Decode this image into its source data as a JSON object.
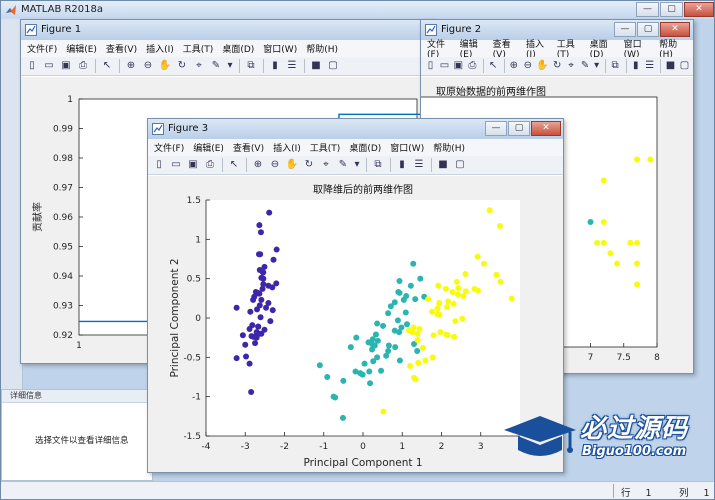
{
  "app": {
    "title": "MATLAB R2018a",
    "details_panel": {
      "header": "详细信息",
      "message": "选择文件以查看详细信息"
    },
    "status": {
      "row_label": "行",
      "row_value": "1",
      "col_label": "列",
      "col_value": "1"
    }
  },
  "window_buttons": {
    "minimize": "—",
    "restore": "▢",
    "close": "✕"
  },
  "figure_menu": [
    "文件(F)",
    "编辑(E)",
    "查看(V)",
    "插入(I)",
    "工具(T)",
    "桌面(D)",
    "窗口(W)",
    "帮助(H)"
  ],
  "toolbar_icons": [
    "new-figure-icon",
    "open-file-icon",
    "save-icon",
    "print-icon",
    "sep",
    "edit-plot-icon",
    "sep",
    "zoom-in-icon",
    "zoom-out-icon",
    "pan-icon",
    "rotate-3d-icon",
    "data-cursor-icon",
    "brush-icon",
    "brush-dropdown-icon",
    "sep",
    "link-plot-icon",
    "sep",
    "insert-colorbar-icon",
    "insert-legend-icon",
    "sep",
    "hide-plot-tools-icon",
    "show-plot-tools-icon"
  ],
  "figures": {
    "fig1": {
      "title": "Figure 1",
      "chart_data": {
        "type": "line",
        "title": "",
        "xlabel": "",
        "ylabel": "贡献率",
        "yticks": [
          "1",
          "0.99",
          "0.98",
          "0.97",
          "0.96",
          "0.95",
          "0.94",
          "0.93",
          "0.92"
        ],
        "xticks": [
          "1"
        ],
        "ylim": [
          0.92,
          1.0
        ],
        "series": [
          {
            "x": [
              1,
              2,
              3,
              4
            ],
            "y": [
              0.9246,
              0.9246,
              0.9948,
              1.0
            ]
          }
        ],
        "color": "#0072bd"
      }
    },
    "fig2": {
      "title": "Figure 2",
      "chart_data": {
        "type": "scatter",
        "title": "取原始数据的前两维作图",
        "xticks": [
          "7",
          "7.5",
          "8"
        ],
        "xlim": [
          4,
          8
        ],
        "ylim": [
          2,
          4.4
        ],
        "series": [
          {
            "color": "#3e26a8",
            "points": [
              [
                5.0,
                3.6
              ]
            ]
          },
          {
            "color": "#2ab5b0",
            "points": [
              [
                7.0,
                3.2
              ]
            ]
          },
          {
            "color": "#f9fb0e",
            "points": [
              [
                7.7,
                3.8
              ],
              [
                7.6,
                3.0
              ],
              [
                7.7,
                3.0
              ],
              [
                7.7,
                2.8
              ],
              [
                7.7,
                2.6
              ],
              [
                7.2,
                3.6
              ],
              [
                7.3,
                2.9
              ],
              [
                7.2,
                3.2
              ],
              [
                7.1,
                3.0
              ],
              [
                7.4,
                2.8
              ],
              [
                7.9,
                3.8
              ],
              [
                7.7,
                3.8
              ],
              [
                7.2,
                3.0
              ]
            ]
          }
        ]
      }
    },
    "fig3": {
      "title": "Figure 3",
      "chart_data": {
        "type": "scatter",
        "title": "取降维后的前两维作图",
        "xlabel": "Principal Component 1",
        "ylabel": "Principal Component 2",
        "xticks": [
          "-4",
          "-3",
          "-2",
          "-1",
          "0",
          "1",
          "2",
          "3"
        ],
        "yticks": [
          "1.5",
          "1",
          "0.5",
          "0",
          "-0.5",
          "-1",
          "-1.5"
        ],
        "xlim": [
          -4,
          4
        ],
        "ylim": [
          -1.5,
          1.5
        ],
        "series": [
          {
            "color": "#3e26a8",
            "points": [
              [
                -2.68,
                0.32
              ],
              [
                -2.71,
                -0.18
              ],
              [
                -2.89,
                -0.14
              ],
              [
                -2.75,
                -0.32
              ],
              [
                -2.73,
                0.33
              ],
              [
                -2.28,
                0.74
              ],
              [
                -2.82,
                -0.09
              ],
              [
                -2.63,
                0.16
              ],
              [
                -2.89,
                -0.58
              ],
              [
                -2.67,
                -0.11
              ],
              [
                -2.51,
                0.65
              ],
              [
                -2.61,
                0.01
              ],
              [
                -2.79,
                -0.24
              ],
              [
                -3.22,
                -0.51
              ],
              [
                -2.64,
                1.18
              ],
              [
                -2.39,
                1.34
              ],
              [
                -2.62,
                0.81
              ],
              [
                -2.65,
                0.31
              ],
              [
                -2.2,
                0.87
              ],
              [
                -2.59,
                0.51
              ],
              [
                -2.31,
                0.39
              ],
              [
                -2.54,
                0.43
              ],
              [
                -3.22,
                0.13
              ],
              [
                -2.3,
                0.1
              ],
              [
                -2.36,
                -0.04
              ],
              [
                -2.51,
                -0.15
              ],
              [
                -2.47,
                0.13
              ],
              [
                -2.56,
                0.37
              ],
              [
                -2.64,
                0.31
              ],
              [
                -2.63,
                -0.2
              ],
              [
                -2.59,
                -0.2
              ],
              [
                -2.41,
                0.41
              ],
              [
                -2.65,
                0.81
              ],
              [
                -2.6,
                1.09
              ],
              [
                -2.67,
                -0.11
              ],
              [
                -2.87,
                0.08
              ],
              [
                -2.63,
                0.61
              ],
              [
                -2.8,
                0.23
              ],
              [
                -2.98,
                -0.49
              ],
              [
                -2.59,
                0.23
              ],
              [
                -2.77,
                0.27
              ],
              [
                -2.85,
                -0.94
              ],
              [
                -3.0,
                -0.34
              ],
              [
                -2.41,
                0.19
              ],
              [
                -2.21,
                0.44
              ],
              [
                -2.71,
                -0.25
              ],
              [
                -2.54,
                0.5
              ],
              [
                -2.84,
                -0.23
              ],
              [
                -2.54,
                0.58
              ],
              [
                -2.7,
                0.11
              ],
              [
                -2.55,
                0.58
              ],
              [
                -3.06,
                -0.22
              ]
            ]
          },
          {
            "color": "#2ab5b0",
            "points": [
              [
                1.28,
                0.69
              ],
              [
                0.93,
                0.32
              ],
              [
                1.46,
                0.5
              ],
              [
                0.18,
                -0.83
              ],
              [
                1.09,
                0.07
              ],
              [
                0.64,
                -0.42
              ],
              [
                1.1,
                0.28
              ],
              [
                -0.75,
                -1.0
              ],
              [
                1.04,
                0.23
              ],
              [
                -0.01,
                -0.72
              ],
              [
                -0.51,
                -1.27
              ],
              [
                0.51,
                -0.1
              ],
              [
                0.26,
                -0.55
              ],
              [
                0.98,
                -0.12
              ],
              [
                -0.17,
                -0.25
              ],
              [
                0.93,
                0.47
              ],
              [
                0.66,
                -0.35
              ],
              [
                0.23,
                -0.33
              ],
              [
                0.94,
                -0.54
              ],
              [
                0.04,
                -0.58
              ],
              [
                1.12,
                -0.08
              ],
              [
                0.36,
                -0.07
              ],
              [
                1.3,
                -0.33
              ],
              [
                0.92,
                -0.18
              ],
              [
                0.71,
                0.15
              ],
              [
                0.9,
                0.33
              ],
              [
                1.33,
                0.24
              ],
              [
                1.56,
                0.27
              ],
              [
                0.81,
                -0.16
              ],
              [
                -0.31,
                -0.37
              ],
              [
                -0.07,
                -0.7
              ],
              [
                -0.19,
                -0.68
              ],
              [
                0.14,
                -0.31
              ],
              [
                1.38,
                -0.42
              ],
              [
                0.59,
                -0.48
              ],
              [
                0.81,
                0.2
              ],
              [
                1.22,
                0.41
              ],
              [
                0.82,
                -0.37
              ],
              [
                0.25,
                -0.27
              ],
              [
                0.16,
                -0.68
              ],
              [
                0.46,
                -0.67
              ],
              [
                0.89,
                -0.03
              ],
              [
                0.23,
                -0.4
              ],
              [
                -0.71,
                -1.01
              ],
              [
                0.36,
                -0.5
              ],
              [
                0.33,
                -0.21
              ],
              [
                0.38,
                -0.29
              ],
              [
                0.64,
                0.06
              ],
              [
                -0.91,
                -0.75
              ],
              [
                0.3,
                -0.35
              ],
              [
                -0.5,
                -0.8
              ],
              [
                -1.1,
                -0.6
              ]
            ]
          },
          {
            "color": "#f9fb0e",
            "points": [
              [
                2.53,
                -0.01
              ],
              [
                1.41,
                -0.57
              ],
              [
                2.62,
                0.34
              ],
              [
                1.97,
                -0.18
              ],
              [
                2.35,
                -0.04
              ],
              [
                3.4,
                0.55
              ],
              [
                0.52,
                -1.19
              ],
              [
                2.93,
                0.35
              ],
              [
                2.32,
                -0.24
              ],
              [
                2.92,
                0.78
              ],
              [
                1.66,
                0.24
              ],
              [
                1.8,
                -0.22
              ],
              [
                2.17,
                0.21
              ],
              [
                1.34,
                -0.78
              ],
              [
                1.59,
                -0.54
              ],
              [
                1.9,
                0.12
              ],
              [
                1.95,
                0.04
              ],
              [
                3.49,
                1.17
              ],
              [
                3.79,
                0.25
              ],
              [
                1.3,
                -0.76
              ],
              [
                2.43,
                0.38
              ],
              [
                1.2,
                -0.61
              ],
              [
                3.5,
                0.46
              ],
              [
                1.39,
                -0.2
              ],
              [
                2.28,
                0.33
              ],
              [
                2.61,
                0.56
              ],
              [
                1.26,
                -0.18
              ],
              [
                1.29,
                -0.12
              ],
              [
                2.12,
                -0.21
              ],
              [
                2.39,
                0.46
              ],
              [
                2.84,
                0.37
              ],
              [
                3.23,
                1.37
              ],
              [
                2.16,
                -0.22
              ],
              [
                1.44,
                -0.14
              ],
              [
                1.78,
                -0.5
              ],
              [
                3.08,
                0.69
              ],
              [
                2.14,
                0.14
              ],
              [
                1.9,
                0.05
              ],
              [
                1.17,
                -0.16
              ],
              [
                2.11,
                0.37
              ],
              [
                2.31,
                0.18
              ],
              [
                1.92,
                0.41
              ],
              [
                1.41,
                -0.57
              ],
              [
                2.56,
                0.28
              ],
              [
                2.42,
                0.3
              ],
              [
                1.94,
                0.19
              ],
              [
                1.53,
                -0.38
              ],
              [
                1.76,
                0.08
              ],
              [
                1.9,
                0.12
              ],
              [
                1.39,
                -0.28
              ]
            ]
          }
        ]
      }
    }
  },
  "watermark": {
    "brand": "必过源码",
    "domain": "Biguo100.com"
  }
}
